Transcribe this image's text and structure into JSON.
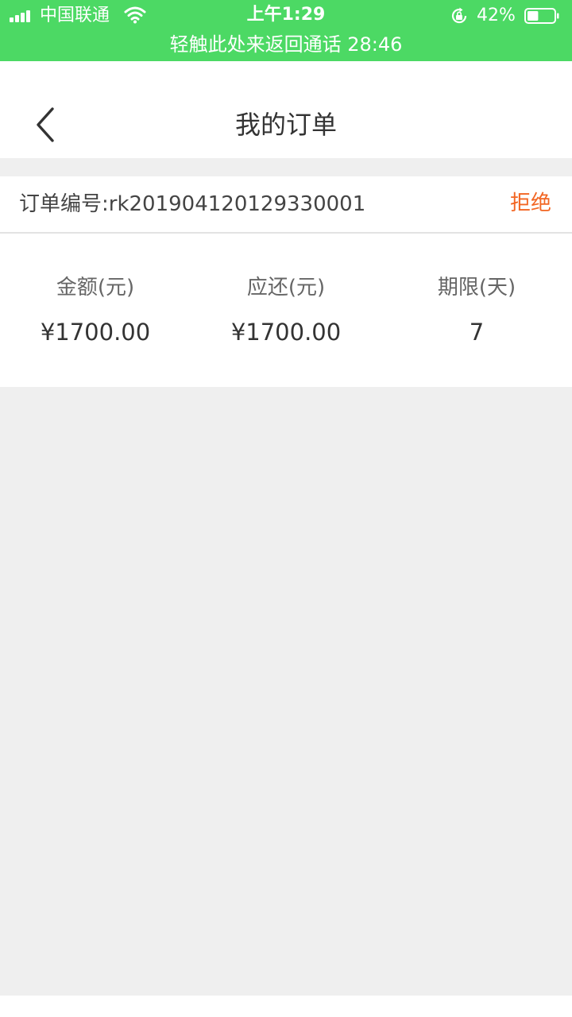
{
  "status_bar": {
    "carrier": "中国联通",
    "time": "上午1:29",
    "battery_percent": "42%",
    "battery_level": 0.42,
    "call_banner": "轻触此处来返回通话 28:46",
    "background_color": "#4cd964"
  },
  "nav": {
    "back_icon": "chevron-left-icon",
    "title": "我的订单"
  },
  "order": {
    "number_label": "订单编号:rk201904120129330001",
    "status_action": "拒绝",
    "status_color": "#f26522",
    "stats": [
      {
        "label": "金额(元)",
        "value": "¥1700.00"
      },
      {
        "label": "应还(元)",
        "value": "¥1700.00"
      },
      {
        "label": "期限(天)",
        "value": "7"
      }
    ]
  }
}
